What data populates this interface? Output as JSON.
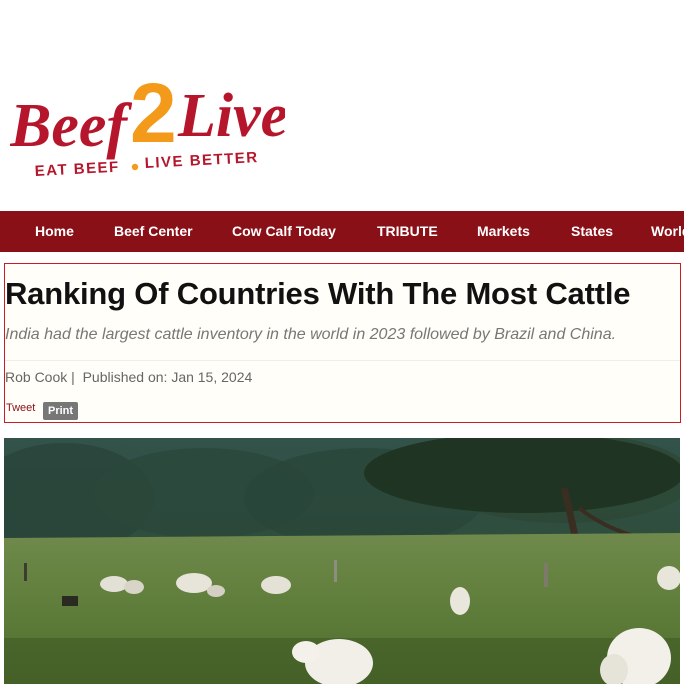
{
  "logo": {
    "brand_part1": "Beef",
    "brand_number": "2",
    "brand_part2": "Live",
    "tagline_left": "EAT BEEF",
    "tagline_right": "LIVE BETTER",
    "colors": {
      "red": "#b5162b",
      "orange": "#f39a1b"
    }
  },
  "nav": {
    "items": [
      "Home",
      "Beef Center",
      "Cow Calf Today",
      "TRIBUTE",
      "Markets",
      "States",
      "World"
    ],
    "background": "#8a1018"
  },
  "article": {
    "title": "Ranking Of Countries With The Most Cattle",
    "subtitle": "India had the largest cattle inventory in the world in 2023 followed by Brazil and China.",
    "author": "Rob Cook",
    "separator": "|",
    "published_label": "Published on:",
    "published_date": "Jan 15, 2024",
    "tweet_label": "Tweet",
    "print_label": "Print"
  },
  "hero_image": {
    "description_icon": "cattle-pasture-photo"
  }
}
